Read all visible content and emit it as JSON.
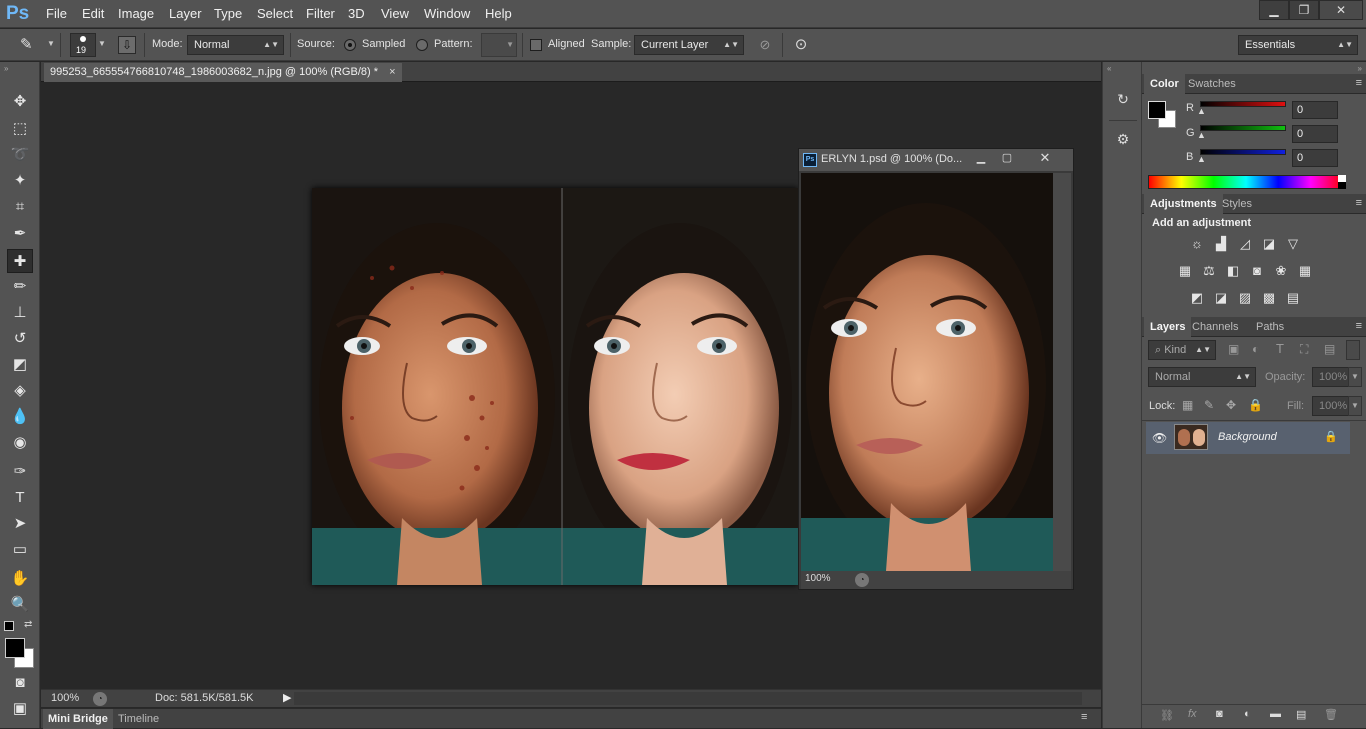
{
  "app": {
    "logo": "Ps"
  },
  "menu": [
    "File",
    "Edit",
    "Image",
    "Layer",
    "Type",
    "Select",
    "Filter",
    "3D",
    "View",
    "Window",
    "Help"
  ],
  "window_controls": {
    "minimize": "▁",
    "restore": "❐",
    "close": "✕"
  },
  "options": {
    "brush_size": "19",
    "mode_label": "Mode:",
    "mode_value": "Normal",
    "source_label": "Source:",
    "sampled_label": "Sampled",
    "pattern_label": "Pattern:",
    "aligned_label": "Aligned",
    "sample_label": "Sample:",
    "sample_value": "Current Layer",
    "workspace": "Essentials"
  },
  "document": {
    "tab_title": "995253_665554766810748_1986003682_n.jpg @ 100% (RGB/8) *",
    "zoom": "100%",
    "doc_info": "Doc: 581.5K/581.5K"
  },
  "floating_doc": {
    "title": "ERLYN 1.psd @ 100% (Do...",
    "zoom": "100%"
  },
  "bottom_tabs": [
    "Mini Bridge",
    "Timeline"
  ],
  "color_panel": {
    "tabs": [
      "Color",
      "Swatches"
    ],
    "channels": [
      {
        "label": "R",
        "value": "0",
        "color": "#e01010"
      },
      {
        "label": "G",
        "value": "0",
        "color": "#10c010"
      },
      {
        "label": "B",
        "value": "0",
        "color": "#1020e0"
      }
    ]
  },
  "adjustments_panel": {
    "tabs": [
      "Adjustments",
      "Styles"
    ],
    "heading": "Add an adjustment"
  },
  "layers_panel": {
    "tabs": [
      "Layers",
      "Channels",
      "Paths"
    ],
    "filter_label": "Kind",
    "blend_mode": "Normal",
    "opacity_label": "Opacity:",
    "opacity_value": "100%",
    "lock_label": "Lock:",
    "fill_label": "Fill:",
    "fill_value": "100%",
    "layers": [
      {
        "name": "Background"
      }
    ]
  }
}
